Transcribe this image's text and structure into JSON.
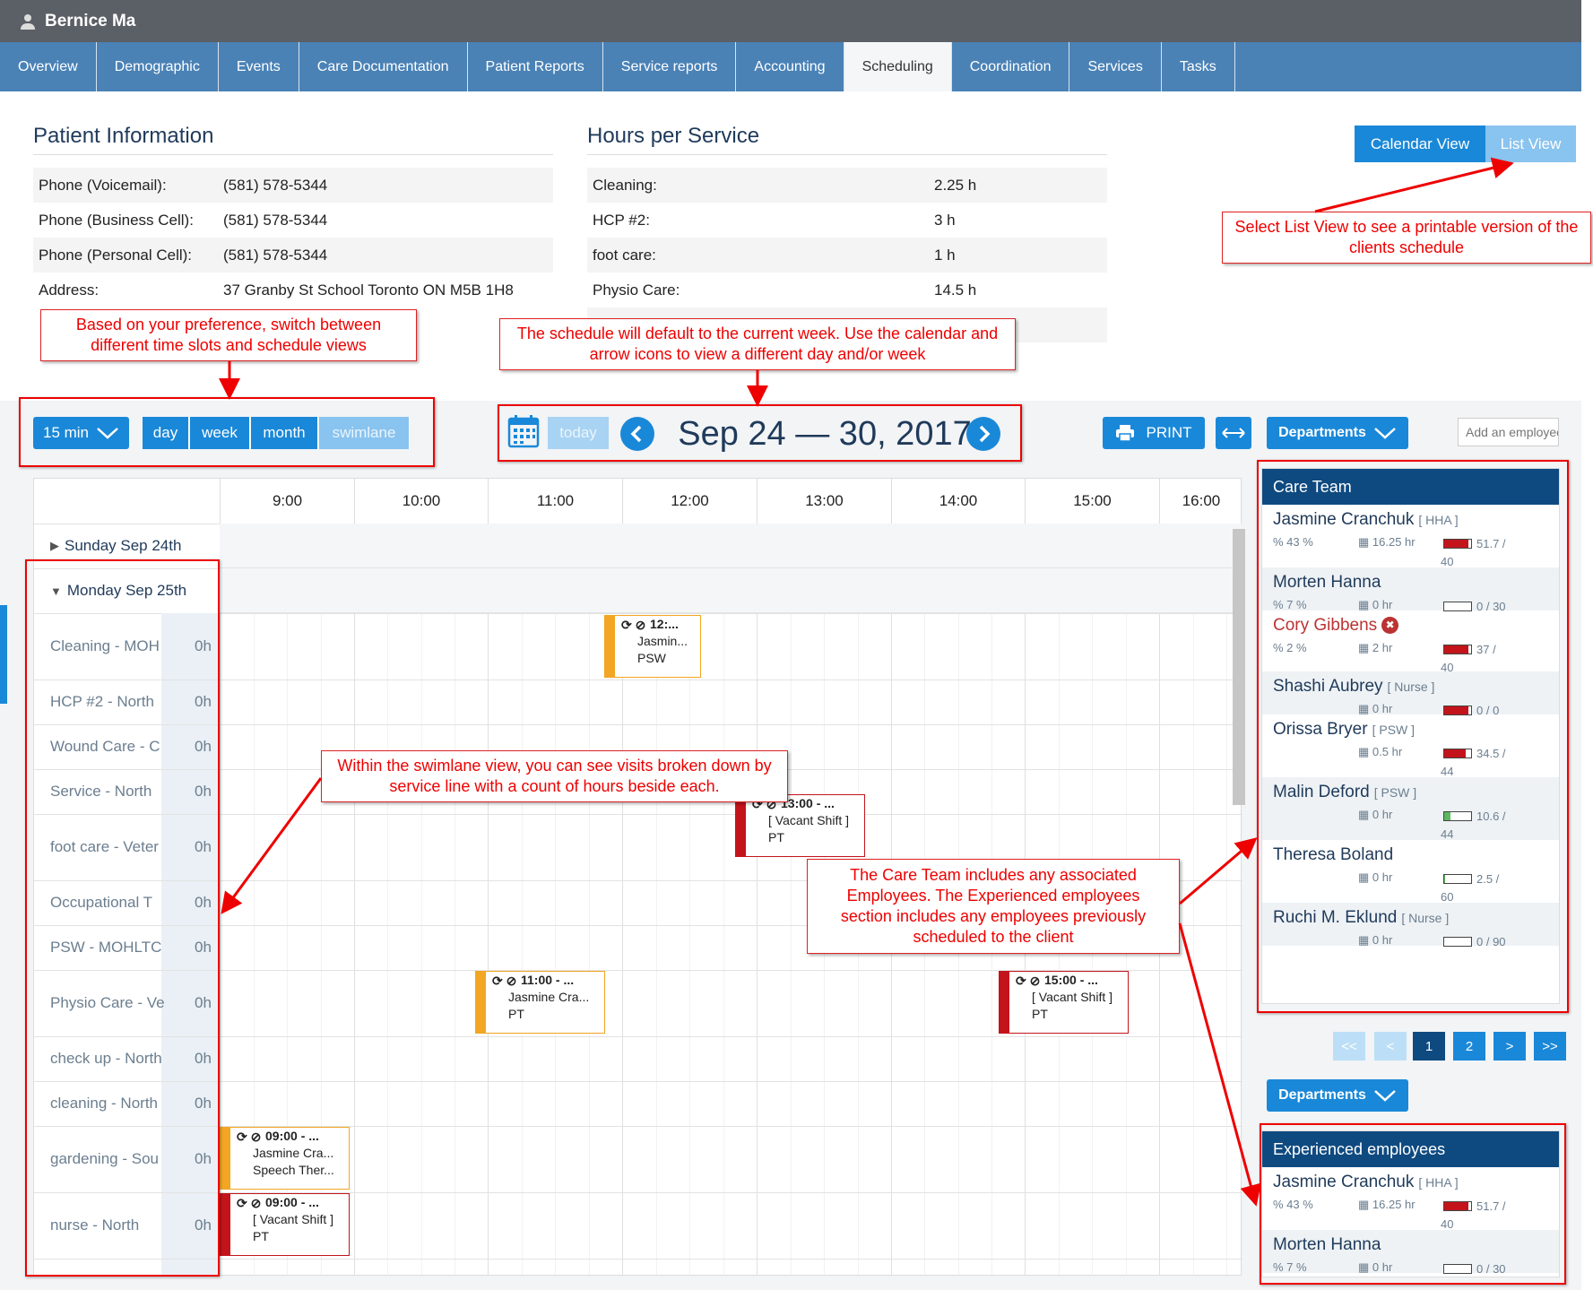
{
  "window": {
    "patient_name": "Bernice Ma"
  },
  "tabs": [
    "Overview",
    "Demographic",
    "Events",
    "Care Documentation",
    "Patient Reports",
    "Service reports",
    "Accounting",
    "Scheduling",
    "Coordination",
    "Services",
    "Tasks"
  ],
  "active_tab": "Scheduling",
  "patient_info": {
    "title": "Patient Information",
    "rows": [
      {
        "label": "Phone (Voicemail):",
        "value": "(581) 578-5344"
      },
      {
        "label": "Phone (Business Cell):",
        "value": "(581) 578-5344"
      },
      {
        "label": "Phone (Personal Cell):",
        "value": "(581) 578-5344"
      },
      {
        "label": "Address:",
        "value": "37 Granby St School Toronto ON M5B 1H8"
      }
    ]
  },
  "hours_per_service": {
    "title": "Hours per Service",
    "rows": [
      {
        "label": "Cleaning:",
        "value": "2.25 h"
      },
      {
        "label": "HCP #2:",
        "value": "3 h"
      },
      {
        "label": "foot care:",
        "value": "1 h"
      },
      {
        "label": "Physio Care:",
        "value": "14.5 h"
      }
    ]
  },
  "view_toggle": {
    "calendar": "Calendar View",
    "list": "List View"
  },
  "toolbar": {
    "slot": "15 min",
    "views": [
      "day",
      "week",
      "month",
      "swimlane"
    ],
    "today": "today",
    "date_range": "Sep 24 — 30, 2017",
    "print": "PRINT",
    "departments": "Departments",
    "add_employee_placeholder": "Add an employee"
  },
  "time_headers": [
    "9:00",
    "10:00",
    "11:00",
    "12:00",
    "13:00",
    "14:00",
    "15:00",
    "16:00"
  ],
  "days": [
    {
      "label": "Sunday Sep 24th",
      "collapsed": true
    },
    {
      "label": "Monday Sep 25th",
      "collapsed": false
    }
  ],
  "lanes": [
    {
      "name": "Cleaning - MOH",
      "hours": "0h"
    },
    {
      "name": "HCP #2 - North",
      "hours": "0h"
    },
    {
      "name": "Wound Care - C",
      "hours": "0h"
    },
    {
      "name": "Service - North",
      "hours": "0h"
    },
    {
      "name": "foot care - Veter",
      "hours": "0h"
    },
    {
      "name": "Occupational T",
      "hours": "0h"
    },
    {
      "name": "PSW - MOHLTC",
      "hours": "0h"
    },
    {
      "name": "Physio Care - Ve",
      "hours": "0h"
    },
    {
      "name": "check up - North",
      "hours": "0h"
    },
    {
      "name": "cleaning - North",
      "hours": "0h"
    },
    {
      "name": "gardening - Sou",
      "hours": "0h"
    },
    {
      "name": "nurse - North",
      "hours": "0h"
    }
  ],
  "events": [
    {
      "time": "12:...",
      "line1": "Jasmin...",
      "line2": "PSW",
      "status_color": "#f2a623"
    },
    {
      "time": "13:00 - ...",
      "line1": "[ Vacant Shift ]",
      "line2": "PT",
      "status_color": "#c3141b"
    },
    {
      "time": "11:00 - ...",
      "line1": "Jasmine Cra...",
      "line2": "PT",
      "status_color": "#f2a623"
    },
    {
      "time": "15:00 - ...",
      "line1": "[ Vacant Shift ]",
      "line2": "PT",
      "status_color": "#c3141b"
    },
    {
      "time": "09:00 - ...",
      "line1": "Jasmine Cra...",
      "line2": "Speech Ther...",
      "status_color": "#f2a623"
    },
    {
      "time": "09:00 - ...",
      "line1": "[ Vacant Shift ]",
      "line2": "PT",
      "status_color": "#c3141b"
    }
  ],
  "care_team": {
    "title": "Care Team",
    "employees": [
      {
        "name": "Jasmine Cranchuk",
        "role": "[ HHA ]",
        "pct": "43 %",
        "hrs": "16.25 hr",
        "cap": "51.7 /",
        "cap2": "40",
        "fill": 0.9,
        "fill_color": "#c3141b"
      },
      {
        "name": "Morten Hanna",
        "role": "",
        "pct": "7 %",
        "hrs": "0 hr",
        "cap": "0 / 30",
        "cap2": "",
        "fill": 0,
        "fill_color": "#c3141b"
      },
      {
        "name": "Cory Gibbens",
        "role": "",
        "pct": "2 %",
        "hrs": "2 hr",
        "cap": "37 /",
        "cap2": "40",
        "fill": 0.9,
        "fill_color": "#c3141b",
        "warning": true
      },
      {
        "name": "Shashi Aubrey",
        "role": "[ Nurse ]",
        "pct": "",
        "hrs": "0 hr",
        "cap": "0 / 0",
        "cap2": "",
        "fill": 0.9,
        "fill_color": "#c3141b"
      },
      {
        "name": "Orissa Bryer",
        "role": "[ PSW ]",
        "pct": "",
        "hrs": "0.5 hr",
        "cap": "34.5 /",
        "cap2": "44",
        "fill": 0.8,
        "fill_color": "#c3141b"
      },
      {
        "name": "Malin Deford",
        "role": "[ PSW ]",
        "pct": "",
        "hrs": "0 hr",
        "cap": "10.6 /",
        "cap2": "44",
        "fill": 0.24,
        "fill_color": "#5cb85c"
      },
      {
        "name": "Theresa Boland",
        "role": "",
        "pct": "",
        "hrs": "0 hr",
        "cap": "2.5 /",
        "cap2": "60",
        "fill": 0.04,
        "fill_color": "#5cb85c"
      },
      {
        "name": "Ruchi M. Eklund",
        "role": "[ Nurse ]",
        "pct": "",
        "hrs": "0 hr",
        "cap": "0 / 90",
        "cap2": "",
        "fill": 0,
        "fill_color": "#5cb85c"
      }
    ]
  },
  "pager": {
    "first": "<<",
    "prev": "<",
    "pages": [
      "1",
      "2"
    ],
    "next": ">",
    "last": ">>"
  },
  "experienced": {
    "title": "Experienced employees",
    "employees": [
      {
        "name": "Jasmine Cranchuk",
        "role": "[ HHA ]",
        "pct": "43 %",
        "hrs": "16.25 hr",
        "cap": "51.7 /",
        "cap2": "40",
        "fill": 0.9,
        "fill_color": "#c3141b"
      },
      {
        "name": "Morten Hanna",
        "role": "",
        "pct": "7 %",
        "hrs": "0 hr",
        "cap": "0 / 30",
        "cap2": "",
        "fill": 0,
        "fill_color": "#c3141b"
      }
    ]
  },
  "callouts": {
    "list_view": "Select List View to see a printable version of the clients schedule",
    "time_slots": "Based on your preference, switch between different time slots and schedule views",
    "default_week": "The schedule will default to the current week. Use the calendar and arrow icons to view a different day and/or week",
    "swimlane": "Within the swimlane view, you can see visits broken down by service line with a count of hours beside each.",
    "care_team": "The Care Team includes any associated Employees. The Experienced employees section includes any employees previously scheduled to the client"
  },
  "colors": {
    "nav": "#4a82b6",
    "header": "#5b5f66",
    "primary": "#1a88d8",
    "panel_head": "#0e4a80",
    "annotation": "#e00000"
  }
}
